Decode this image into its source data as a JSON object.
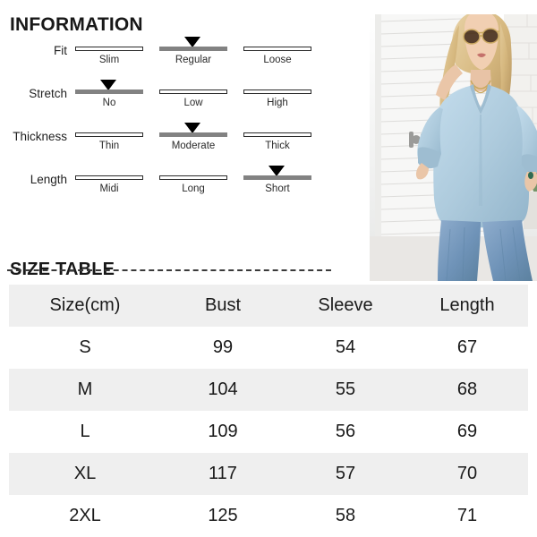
{
  "information": {
    "title": "INFORMATION",
    "attributes": [
      {
        "name": "fit",
        "label": "Fit",
        "selected_index": 1,
        "options": [
          {
            "label": "Slim",
            "active": false
          },
          {
            "label": "Regular",
            "active": true
          },
          {
            "label": "Loose",
            "active": false
          }
        ]
      },
      {
        "name": "stretch",
        "label": "Stretch",
        "selected_index": 0,
        "options": [
          {
            "label": "No",
            "active": true
          },
          {
            "label": "Low",
            "active": false
          },
          {
            "label": "High",
            "active": false
          }
        ]
      },
      {
        "name": "thickness",
        "label": "Thickness",
        "selected_index": 1,
        "options": [
          {
            "label": "Thin",
            "active": false
          },
          {
            "label": "Moderate",
            "active": true
          },
          {
            "label": "Thick",
            "active": false
          }
        ]
      },
      {
        "name": "length",
        "label": "Length",
        "selected_index": 2,
        "options": [
          {
            "label": "Midi",
            "active": false
          },
          {
            "label": "Long",
            "active": false
          },
          {
            "label": "Short",
            "active": true
          }
        ]
      }
    ]
  },
  "photo": {
    "alt": "Woman wearing light blue V-neck long-sleeve blouse with blue jeans and sunglasses, standing in front of a white slatted door and white brick wall with a green plant",
    "garment_color": "#aecbdd",
    "jeans_color": "#7d9cc0"
  },
  "size_table": {
    "title": "SIZE TABLE",
    "columns": [
      "Size(cm)",
      "Bust",
      "Sleeve",
      "Length"
    ],
    "rows": [
      {
        "size": "S",
        "bust": "99",
        "sleeve": "54",
        "length": "67"
      },
      {
        "size": "M",
        "bust": "104",
        "sleeve": "55",
        "length": "68"
      },
      {
        "size": "L",
        "bust": "109",
        "sleeve": "56",
        "length": "69"
      },
      {
        "size": "XL",
        "bust": "117",
        "sleeve": "57",
        "length": "70"
      },
      {
        "size": "2XL",
        "bust": "125",
        "sleeve": "58",
        "length": "71"
      }
    ]
  },
  "colors": {
    "header_band": "#efefef",
    "row_band": "#efefef",
    "active_bar": "#828282",
    "inactive_bar_border": "#2b2b2b",
    "marker": "#000000",
    "text": "#1a1a1a"
  }
}
